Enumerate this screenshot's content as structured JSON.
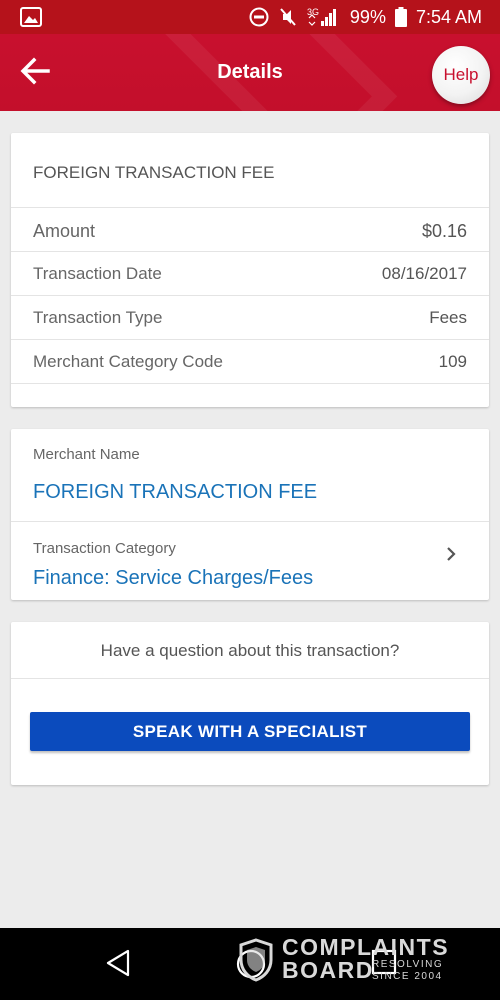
{
  "status_bar": {
    "battery": "99%",
    "time": "7:54 AM",
    "network": "3G",
    "icons": [
      "image-icon",
      "do-not-disturb-icon",
      "vibrate-off-icon",
      "signal-icon",
      "battery-icon"
    ]
  },
  "header": {
    "title": "Details",
    "help_label": "Help",
    "back_icon": "arrow-left-icon"
  },
  "summary": {
    "heading": "FOREIGN TRANSACTION FEE",
    "rows": [
      {
        "label": "Amount",
        "value": "$0.16"
      },
      {
        "label": "Transaction Date",
        "value": "08/16/2017"
      },
      {
        "label": "Transaction Type",
        "value": "Fees"
      },
      {
        "label": "Merchant Category Code",
        "value": "109"
      }
    ]
  },
  "merchant": {
    "name_label": "Merchant Name",
    "name_value": "FOREIGN TRANSACTION FEE",
    "category_label": "Transaction Category",
    "category_value": "Finance: Service Charges/Fees"
  },
  "question": {
    "text": "Have a question about this transaction?",
    "button_label": "SPEAK WITH A SPECIALIST"
  },
  "navigation": {
    "buttons": [
      "back-triangle-icon",
      "home-circle-icon",
      "recents-square-icon"
    ]
  },
  "watermark": {
    "line1": "COMPLAINTS",
    "line2": "BOARD",
    "tagline": "RESOLVING SINCE 2004"
  },
  "colors": {
    "brand_red": "#c8102e",
    "link_blue": "#1a73b8",
    "button_blue": "#0b4bbd",
    "background": "#ececec"
  }
}
